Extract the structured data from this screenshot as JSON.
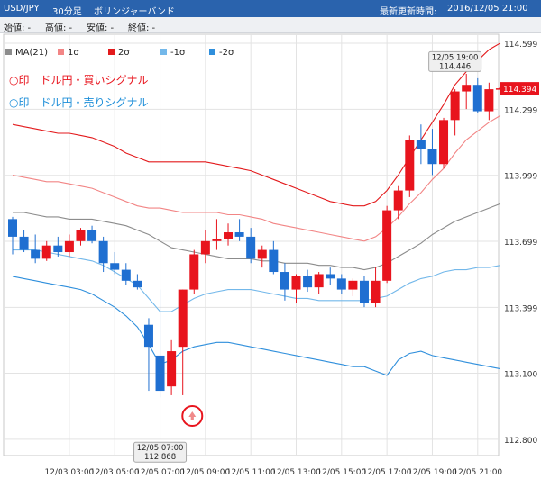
{
  "header": {
    "symbol": "USD/JPY",
    "timeframe": "30分足",
    "indicator": "ボリンジャーバンド",
    "updated_label": "最新更新時間:",
    "updated_value": "2016/12/05 21:00"
  },
  "ohlc_bar": {
    "open": "始値: -",
    "high": "高値: -",
    "low": "安値: -",
    "close": "終値: -"
  },
  "legend": [
    "MA(21)",
    "1σ",
    "2σ",
    "-1σ",
    "-2σ"
  ],
  "signals": {
    "buy": "○印　ドル円・買いシグナル",
    "sell": "○印　ドル円・売りシグナル"
  },
  "colors": {
    "bg": "#ffffff",
    "header": "#2a63ad",
    "up": "#e8141d",
    "down": "#1f6fd1",
    "ma": "#8c8c8c",
    "plus1": "#f28585",
    "plus2": "#e31a1c",
    "minus1": "#73b8ea",
    "minus2": "#2f8fdc",
    "grid": "#e3e3e3",
    "price_tag": "#e8141d",
    "signal_marker": "#e8141d"
  },
  "chart_data": {
    "type": "candlestick",
    "yticks": [
      "114.599",
      "114.299",
      "113.999",
      "113.699",
      "113.399",
      "113.100",
      "112.800"
    ],
    "ylim": [
      112.75,
      114.65
    ],
    "xlabels": [
      "12/03 03:00",
      "12/03 05:00",
      "12/05 07:00",
      "12/05 09:00",
      "12/05 11:00",
      "12/05 13:00",
      "12/05 15:00",
      "12/05 17:00",
      "12/05 19:00",
      "12/05 21:00"
    ],
    "x_unit": "30分",
    "x_range_bars": [
      0,
      44
    ],
    "xlabel_bars": [
      5,
      9,
      13,
      17,
      21,
      25,
      29,
      33,
      37,
      41
    ],
    "current_price": "114.394",
    "annotations": [
      {
        "time": "12/05 19:00",
        "value": "114.446",
        "bar": 39,
        "price": 114.446,
        "pos": "above"
      },
      {
        "time": "12/05 07:00",
        "value": "112.868",
        "bar": 13,
        "price": 112.868,
        "pos": "below"
      }
    ],
    "buy_signal_bar": 16,
    "candles": [
      {
        "o": 113.8,
        "h": 113.81,
        "l": 113.64,
        "c": 113.72
      },
      {
        "o": 113.72,
        "h": 113.75,
        "l": 113.65,
        "c": 113.66
      },
      {
        "o": 113.66,
        "h": 113.73,
        "l": 113.6,
        "c": 113.62
      },
      {
        "o": 113.62,
        "h": 113.7,
        "l": 113.61,
        "c": 113.68
      },
      {
        "o": 113.68,
        "h": 113.72,
        "l": 113.63,
        "c": 113.65
      },
      {
        "o": 113.65,
        "h": 113.73,
        "l": 113.63,
        "c": 113.7
      },
      {
        "o": 113.7,
        "h": 113.76,
        "l": 113.68,
        "c": 113.75
      },
      {
        "o": 113.75,
        "h": 113.77,
        "l": 113.69,
        "c": 113.7
      },
      {
        "o": 113.7,
        "h": 113.72,
        "l": 113.56,
        "c": 113.6
      },
      {
        "o": 113.6,
        "h": 113.65,
        "l": 113.55,
        "c": 113.57
      },
      {
        "o": 113.57,
        "h": 113.6,
        "l": 113.5,
        "c": 113.52
      },
      {
        "o": 113.52,
        "h": 113.55,
        "l": 113.48,
        "c": 113.49
      },
      {
        "o": 113.32,
        "h": 113.35,
        "l": 113.02,
        "c": 113.22
      },
      {
        "o": 113.18,
        "h": 113.48,
        "l": 112.99,
        "c": 113.02
      },
      {
        "o": 113.04,
        "h": 113.25,
        "l": 113.0,
        "c": 113.2
      },
      {
        "o": 113.22,
        "h": 113.48,
        "l": 113.0,
        "c": 113.48
      },
      {
        "o": 113.48,
        "h": 113.66,
        "l": 113.46,
        "c": 113.64
      },
      {
        "o": 113.64,
        "h": 113.75,
        "l": 113.6,
        "c": 113.7
      },
      {
        "o": 113.7,
        "h": 113.8,
        "l": 113.66,
        "c": 113.71
      },
      {
        "o": 113.71,
        "h": 113.78,
        "l": 113.68,
        "c": 113.74
      },
      {
        "o": 113.74,
        "h": 113.8,
        "l": 113.7,
        "c": 113.72
      },
      {
        "o": 113.72,
        "h": 113.76,
        "l": 113.6,
        "c": 113.62
      },
      {
        "o": 113.62,
        "h": 113.68,
        "l": 113.58,
        "c": 113.66
      },
      {
        "o": 113.66,
        "h": 113.7,
        "l": 113.55,
        "c": 113.56
      },
      {
        "o": 113.56,
        "h": 113.6,
        "l": 113.43,
        "c": 113.48
      },
      {
        "o": 113.48,
        "h": 113.55,
        "l": 113.42,
        "c": 113.54
      },
      {
        "o": 113.54,
        "h": 113.57,
        "l": 113.47,
        "c": 113.49
      },
      {
        "o": 113.49,
        "h": 113.56,
        "l": 113.46,
        "c": 113.55
      },
      {
        "o": 113.55,
        "h": 113.58,
        "l": 113.5,
        "c": 113.53
      },
      {
        "o": 113.53,
        "h": 113.55,
        "l": 113.46,
        "c": 113.48
      },
      {
        "o": 113.48,
        "h": 113.53,
        "l": 113.45,
        "c": 113.52
      },
      {
        "o": 113.52,
        "h": 113.54,
        "l": 113.4,
        "c": 113.42
      },
      {
        "o": 113.42,
        "h": 113.58,
        "l": 113.4,
        "c": 113.52
      },
      {
        "o": 113.52,
        "h": 113.86,
        "l": 113.51,
        "c": 113.84
      },
      {
        "o": 113.84,
        "h": 113.95,
        "l": 113.8,
        "c": 113.93
      },
      {
        "o": 113.93,
        "h": 114.18,
        "l": 113.9,
        "c": 114.16
      },
      {
        "o": 114.16,
        "h": 114.23,
        "l": 114.05,
        "c": 114.12
      },
      {
        "o": 114.12,
        "h": 114.21,
        "l": 114.0,
        "c": 114.05
      },
      {
        "o": 114.05,
        "h": 114.26,
        "l": 114.03,
        "c": 114.25
      },
      {
        "o": 114.25,
        "h": 114.39,
        "l": 114.18,
        "c": 114.38
      },
      {
        "o": 114.38,
        "h": 114.46,
        "l": 114.3,
        "c": 114.41
      },
      {
        "o": 114.41,
        "h": 114.44,
        "l": 114.28,
        "c": 114.29
      },
      {
        "o": 114.29,
        "h": 114.42,
        "l": 114.25,
        "c": 114.39
      },
      {
        "o": 114.39,
        "h": 114.4,
        "l": 114.37,
        "c": 114.394
      }
    ],
    "series": [
      {
        "name": "MA(21)",
        "values": [
          113.83,
          113.83,
          113.82,
          113.81,
          113.81,
          113.8,
          113.8,
          113.8,
          113.79,
          113.78,
          113.77,
          113.75,
          113.73,
          113.7,
          113.67,
          113.66,
          113.65,
          113.64,
          113.63,
          113.62,
          113.62,
          113.62,
          113.61,
          113.61,
          113.6,
          113.6,
          113.6,
          113.59,
          113.59,
          113.58,
          113.58,
          113.57,
          113.58,
          113.6,
          113.63,
          113.66,
          113.69,
          113.73,
          113.76,
          113.79,
          113.81,
          113.83,
          113.85,
          113.87
        ]
      },
      {
        "name": "1σ",
        "values": [
          114.0,
          113.99,
          113.98,
          113.97,
          113.97,
          113.96,
          113.95,
          113.94,
          113.92,
          113.9,
          113.88,
          113.86,
          113.85,
          113.85,
          113.84,
          113.83,
          113.83,
          113.83,
          113.83,
          113.82,
          113.82,
          113.81,
          113.8,
          113.78,
          113.77,
          113.76,
          113.75,
          113.74,
          113.73,
          113.72,
          113.71,
          113.7,
          113.72,
          113.76,
          113.81,
          113.87,
          113.92,
          113.98,
          114.03,
          114.1,
          114.16,
          114.2,
          114.24,
          114.27
        ]
      },
      {
        "name": "2σ",
        "values": [
          114.23,
          114.22,
          114.21,
          114.2,
          114.19,
          114.19,
          114.18,
          114.17,
          114.15,
          114.13,
          114.1,
          114.08,
          114.06,
          114.06,
          114.06,
          114.06,
          114.06,
          114.06,
          114.05,
          114.04,
          114.03,
          114.02,
          114.0,
          113.98,
          113.96,
          113.94,
          113.92,
          113.9,
          113.88,
          113.87,
          113.86,
          113.86,
          113.88,
          113.93,
          114.0,
          114.08,
          114.16,
          114.24,
          114.32,
          114.41,
          114.47,
          114.52,
          114.57,
          114.6
        ]
      },
      {
        "name": "-1σ",
        "values": [
          113.66,
          113.66,
          113.66,
          113.65,
          113.64,
          113.63,
          113.62,
          113.61,
          113.59,
          113.56,
          113.53,
          113.5,
          113.44,
          113.38,
          113.38,
          113.41,
          113.44,
          113.46,
          113.47,
          113.48,
          113.48,
          113.48,
          113.47,
          113.46,
          113.45,
          113.44,
          113.44,
          113.43,
          113.43,
          113.43,
          113.43,
          113.43,
          113.44,
          113.45,
          113.48,
          113.51,
          113.53,
          113.54,
          113.56,
          113.57,
          113.57,
          113.58,
          113.58,
          113.59
        ]
      },
      {
        "name": "-2σ",
        "values": [
          113.54,
          113.53,
          113.52,
          113.51,
          113.5,
          113.49,
          113.48,
          113.46,
          113.43,
          113.4,
          113.36,
          113.31,
          113.23,
          113.14,
          113.16,
          113.2,
          113.22,
          113.23,
          113.24,
          113.24,
          113.23,
          113.22,
          113.21,
          113.2,
          113.19,
          113.18,
          113.17,
          113.16,
          113.15,
          113.14,
          113.13,
          113.13,
          113.11,
          113.09,
          113.16,
          113.19,
          113.2,
          113.18,
          113.17,
          113.16,
          113.15,
          113.14,
          113.13,
          113.12
        ]
      }
    ]
  }
}
